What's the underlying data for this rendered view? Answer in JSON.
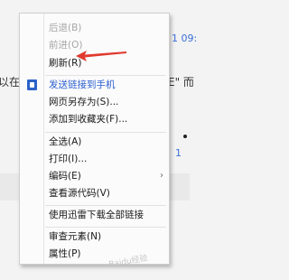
{
  "background": {
    "left_fragment": "以在I",
    "right_fragment": "E\" 而",
    "top_right_fragment": "1 09:",
    "side_number": "1"
  },
  "menu": {
    "items": [
      {
        "label": "后退(B)",
        "enabled": false
      },
      {
        "label": "前进(O)",
        "enabled": false
      },
      {
        "label": "刷新(R)",
        "enabled": true
      },
      {
        "label": "发送链接到手机",
        "enabled": true,
        "icon": "send-to-phone-icon"
      },
      {
        "label": "网页另存为(S)...",
        "enabled": true
      },
      {
        "label": "添加到收藏夹(F)...",
        "enabled": true
      },
      {
        "label": "全选(A)",
        "enabled": true
      },
      {
        "label": "打印(I)...",
        "enabled": true
      },
      {
        "label": "编码(E)",
        "enabled": true,
        "submenu": true
      },
      {
        "label": "查看源代码(V)",
        "enabled": true
      },
      {
        "label": "使用迅雷下载全部链接",
        "enabled": true
      },
      {
        "label": "审查元素(N)",
        "enabled": true
      },
      {
        "label": "属性(P)",
        "enabled": true
      }
    ]
  },
  "annotation_color": "#e03a2f",
  "watermark": "Baidu经验"
}
